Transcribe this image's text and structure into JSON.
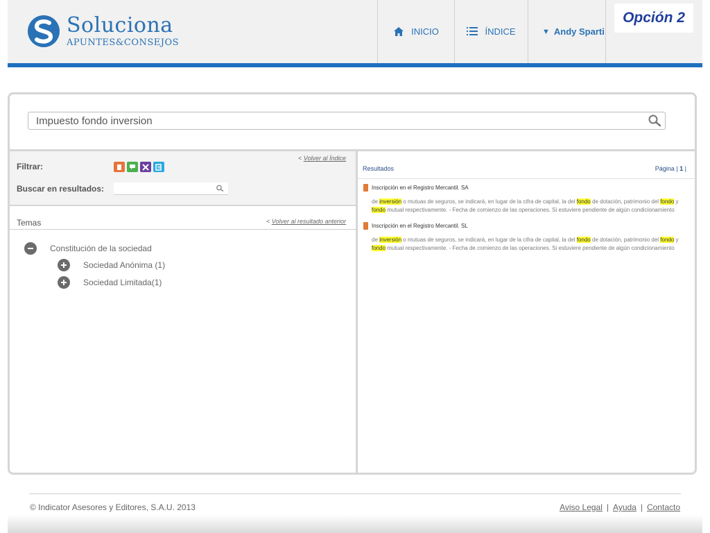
{
  "header": {
    "logo_title": "Soluciona",
    "logo_subtitle": "APUNTES&CONSEJOS",
    "nav": [
      {
        "label": "INICIO",
        "icon": "home-icon"
      },
      {
        "label": "ÍNDICE",
        "icon": "list-icon"
      },
      {
        "label": "Andy Sparti",
        "icon": "caret-down-icon"
      }
    ],
    "option_badge": "Opción 2",
    "accent_color": "#1e6fbf"
  },
  "search": {
    "query": "Impuesto fondo inversion",
    "icon": "search-icon"
  },
  "filters": {
    "filter_label": "Filtrar:",
    "back_to_index": "Volver al Índice",
    "search_results_label": "Buscar en resultados:",
    "search_results_value": "",
    "filter_icons": [
      {
        "name": "filter-orange-icon",
        "color": "#e8733a"
      },
      {
        "name": "filter-green-icon",
        "color": "#4caf50"
      },
      {
        "name": "filter-purple-icon",
        "color": "#6a3fa0"
      },
      {
        "name": "filter-cyan-icon",
        "color": "#29a9e0"
      }
    ]
  },
  "temas": {
    "title": "Temas",
    "back_to_previous": "Volver al resultado anterior",
    "tree": [
      {
        "label": "Constitución de la sociedad",
        "state": "expanded",
        "level": 0
      },
      {
        "label": "Sociedad Anónima (1)",
        "state": "collapsed",
        "level": 1
      },
      {
        "label": "Sociedad Limitada(1)",
        "state": "collapsed",
        "level": 1
      }
    ]
  },
  "results": {
    "title": "Resultados",
    "page_label": "Página",
    "page_current": "1",
    "items": [
      {
        "title": "Inscripción en el Registro Mercantil. SA",
        "line1": [
          "de ",
          "inversión",
          " o mutuas de seguros, se indicará, en lugar de la cifra de capital, la del ",
          "fondo",
          " de dotación, patrimonio del ",
          "fondo",
          " y"
        ],
        "line2": [
          "",
          "fondo",
          " mutual respectivamente. - Fecha de comienzo de las operaciones. Si estuviere pendiente de algún condicionamiento"
        ]
      },
      {
        "title": "Inscripción en el Registro Mercantil. SL",
        "line1": [
          "de ",
          "inversión",
          " o mutuas de seguros, se indicará, en lugar de la cifra de capital, la del ",
          "fondo",
          " de dotación, patrimonio del ",
          "fondo",
          " y"
        ],
        "line2": [
          "",
          "fondo",
          " mutual respectivamente. - Fecha de comienzo de las operaciones. Si estuviere pendiente de algún condicionamiento"
        ]
      }
    ]
  },
  "footer": {
    "copyright": "© Indicator Asesores y Editores, S.A.U. 2013",
    "links": [
      "Aviso Legal",
      "Ayuda",
      "Contacto"
    ],
    "separator": "|"
  }
}
